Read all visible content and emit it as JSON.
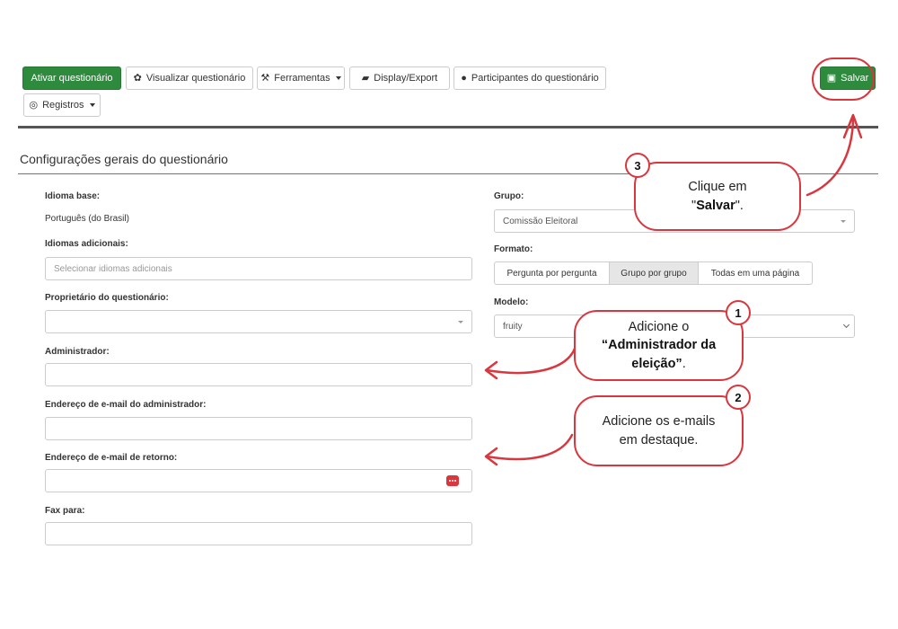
{
  "toolbar": {
    "activate": "Ativar questionário",
    "view": "Visualizar questionário",
    "tools": "Ferramentas",
    "display_export": "Display/Export",
    "participants": "Participantes do questionário",
    "logs": "Registros",
    "save": "Salvar"
  },
  "section_title": "Configurações gerais do questionário",
  "left": {
    "base_lang_label": "Idioma base:",
    "base_lang_value": "Português (do Brasil)",
    "add_lang_label": "Idiomas adicionais:",
    "add_lang_placeholder": "Selecionar idiomas adicionais",
    "owner_label": "Proprietário do questionário:",
    "owner_value": "",
    "admin_label": "Administrador:",
    "admin_value": "",
    "admin_email_label": "Endereço de e-mail do administrador:",
    "admin_email_value": "",
    "bounce_email_label": "Endereço de e-mail de retorno:",
    "bounce_email_value": "",
    "fax_label": "Fax para:",
    "fax_value": ""
  },
  "right": {
    "group_label": "Grupo:",
    "group_value": "Comissão Eleitoral",
    "format_label": "Formato:",
    "format_options": [
      "Pergunta por pergunta",
      "Grupo por grupo",
      "Todas em uma página"
    ],
    "format_selected": "Grupo por grupo",
    "template_label": "Modelo:",
    "template_value": "fruity"
  },
  "callouts": {
    "one": {
      "num": "1",
      "line1": "Adicione o",
      "bold": "“Administrador da eleição”",
      "tail": "."
    },
    "two": {
      "num": "2",
      "line1": "Adicione os e-mails",
      "line2": "em destaque."
    },
    "three": {
      "num": "3",
      "line1": "Clique em",
      "quote_open": "\"",
      "bold": "Salvar",
      "quote_close": "\"."
    }
  },
  "colors": {
    "primary_green": "#2e8b3d",
    "annotation_red": "#d9363e"
  }
}
